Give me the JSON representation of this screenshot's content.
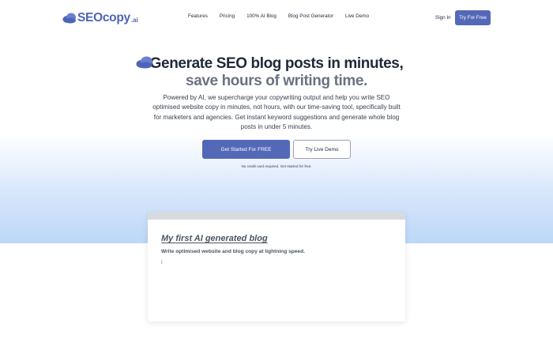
{
  "brand": {
    "name": "SEOcopy",
    "suffix": ".ai",
    "color": "#4e64b8"
  },
  "nav": {
    "items": [
      {
        "label": "Features"
      },
      {
        "label": "Pricing"
      },
      {
        "label": "100% AI Blog"
      },
      {
        "label": "Blog Post Generator"
      },
      {
        "label": "Live Demo"
      }
    ],
    "signin": "Sign In",
    "try_free": "Try For Free"
  },
  "hero": {
    "title_line1": "Generate SEO blog posts in minutes,",
    "title_line2": "save hours of writing time.",
    "description": "Powered by AI, we supercharge your copywriting output and help you write SEO optimised website copy in minutes, not hours, with our time-saving tool, specifically built for marketers and agencies. Get instant keyword suggestions and generate whole blog posts in under 5 minutes.",
    "cta_primary": "Get Started For FREE",
    "cta_secondary": "Try Live Demo",
    "note": "No credit card required. Get started for free."
  },
  "demo_card": {
    "title": "My first AI generated blog",
    "subtitle": "Write optimised website and blog copy at lightning speed.",
    "typed_text": "I"
  },
  "colors": {
    "accent": "#5468b8",
    "gradient_bottom": "#bcd7f8"
  }
}
